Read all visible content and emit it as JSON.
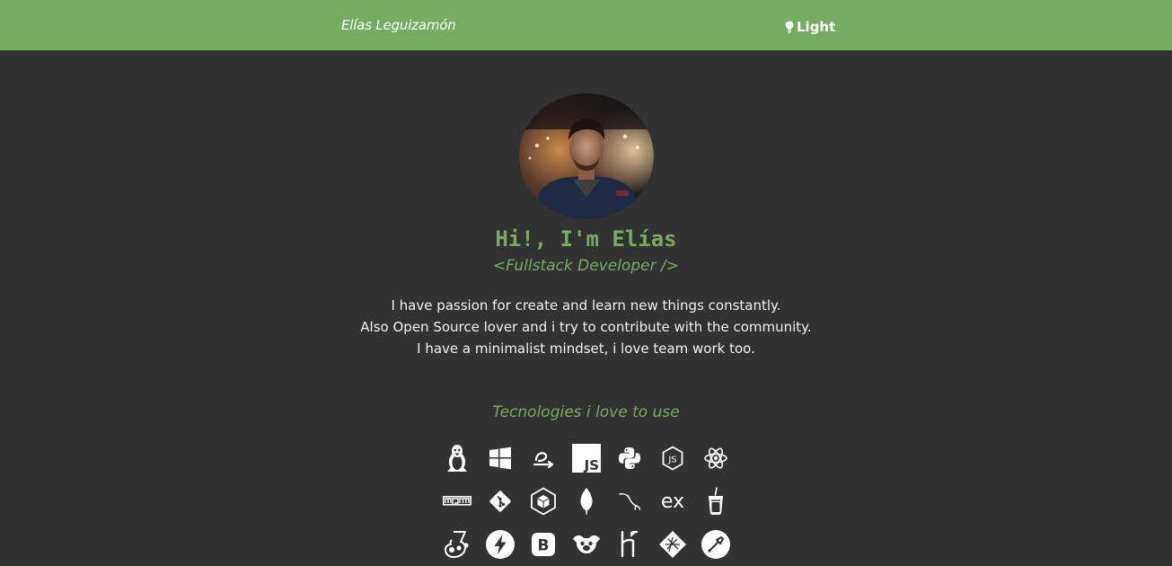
{
  "navbar": {
    "brand": "Elías Leguizamón",
    "theme_toggle_label": "Light",
    "theme_toggle_icon": "lightbulb-icon",
    "background_color": "#74ad5f"
  },
  "hero": {
    "greeting": "Hi!, I'm Elías",
    "role": "<Fullstack Developer />",
    "bio": [
      "I have passion for create and learn new things constantly.",
      "Also Open Source lover and i try to contribute with the community.",
      "I have a minimalist mindset, i love team work too."
    ]
  },
  "technologies": {
    "title": "Tecnologies i love to use",
    "rows": [
      [
        "linux-icon",
        "windows-icon",
        "elementary-icon",
        "javascript-icon",
        "python-icon",
        "nodejs-icon",
        "react-icon"
      ],
      [
        "npm-icon",
        "git-icon",
        "webpack-icon",
        "mongodb-icon",
        "mysql-icon",
        "express-icon",
        "gulp-icon"
      ],
      [
        "jest-icon",
        "nuxt-icon",
        "bootstrap-icon",
        "pug-icon",
        "heroku-icon",
        "netlify-icon",
        "postman-icon"
      ]
    ]
  },
  "colors": {
    "accent": "#74ad5f",
    "background": "#323232",
    "text": "#f0f0f0"
  }
}
